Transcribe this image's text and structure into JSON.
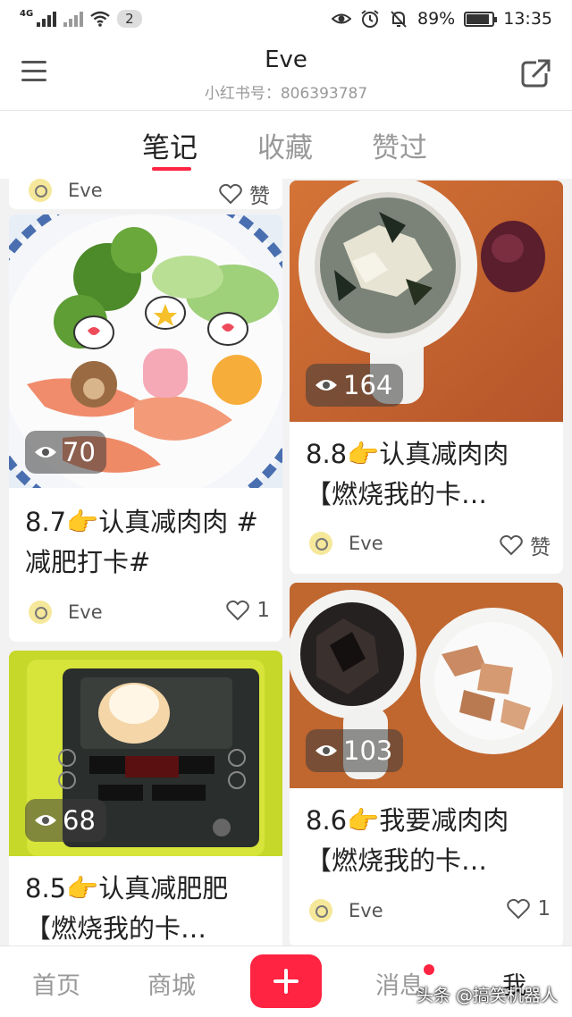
{
  "status_bar": {
    "network": "4G",
    "notification_count": "2",
    "battery_text": "89%",
    "battery_level": 0.89,
    "time": "13:35"
  },
  "header": {
    "name": "Eve",
    "red_id": "小红书号：806393787"
  },
  "tabs": [
    {
      "label": "笔记",
      "active": true
    },
    {
      "label": "收藏",
      "active": false
    },
    {
      "label": "赞过",
      "active": false
    }
  ],
  "partial_top": {
    "author": "Eve",
    "likes": "赞"
  },
  "notes": [
    {
      "views": "70",
      "title": "8.7👉认真减肉肉 #减肥打卡#",
      "author": "Eve",
      "likes": "1"
    },
    {
      "views": "164",
      "title": "8.8👉认真减肉肉【燃烧我的卡…",
      "author": "Eve",
      "likes": "赞"
    },
    {
      "views": "68",
      "title": "8.5👉认真减肥肥【燃烧我的卡…",
      "author": "Eve",
      "likes": ""
    },
    {
      "views": "103",
      "title": "8.6👉我要减肉肉【燃烧我的卡…",
      "author": "Eve",
      "likes": "1"
    }
  ],
  "bottom_nav": {
    "home": "首页",
    "mall": "商城",
    "messages": "消息",
    "me": "我",
    "watermark": "头条 @搞笑机器人"
  },
  "colors": {
    "accent": "#ff2442",
    "background": "#f2f2f2"
  },
  "icons": [
    "menu-icon",
    "share-icon",
    "eye-icon",
    "heart-icon",
    "plus-icon",
    "alarm-icon",
    "eye-comfort-icon",
    "mute-icon",
    "wifi-icon"
  ]
}
